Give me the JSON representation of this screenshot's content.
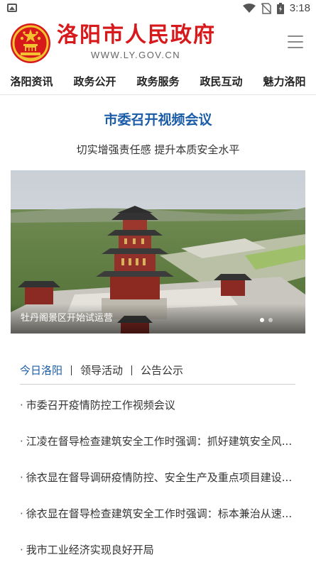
{
  "status_bar": {
    "time": "3:18",
    "icons": [
      "image-icon",
      "wifi-icon",
      "no-sim-icon",
      "battery-icon"
    ]
  },
  "header": {
    "site_title": "洛阳市人民政府",
    "site_url": "WWW.LY.GOV.CN",
    "logo": "national-emblem-icon",
    "menu_icon": "hamburger-menu-icon"
  },
  "nav": {
    "items": [
      {
        "label": "洛阳资讯"
      },
      {
        "label": "政务公开"
      },
      {
        "label": "政务服务"
      },
      {
        "label": "政民互动"
      },
      {
        "label": "魅力洛阳"
      }
    ]
  },
  "feature": {
    "headline": "市委召开视频会议",
    "subheadline": "切实增强责任感 提升本质安全水平"
  },
  "banner": {
    "caption": "牡丹阁景区开始试运营",
    "slide_count": 2,
    "active_slide": 1
  },
  "tabs": {
    "items": [
      {
        "label": "今日洛阳",
        "active": true
      },
      {
        "label": "领导活动",
        "active": false
      },
      {
        "label": "公告公示",
        "active": false
      }
    ]
  },
  "news": {
    "items": [
      {
        "title": "市委召开疫情防控工作视频会议"
      },
      {
        "title": "江凌在督导检查建筑安全工作时强调：抓好建筑安全风..."
      },
      {
        "title": "徐衣显在督导调研疫情防控、安全生产及重点项目建设..."
      },
      {
        "title": "徐衣显在督导检查建筑安全工作时强调：标本兼治从速..."
      },
      {
        "title": "我市工业经济实现良好开局"
      }
    ]
  },
  "colors": {
    "brand_red": "#d7191c",
    "accent_blue": "#1a5ca8"
  }
}
